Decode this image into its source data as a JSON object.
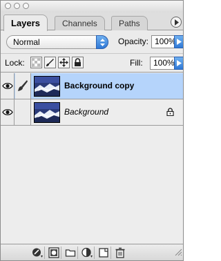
{
  "tabs": [
    {
      "label": "Layers",
      "active": true
    },
    {
      "label": "Channels",
      "active": false
    },
    {
      "label": "Paths",
      "active": false
    }
  ],
  "blend_mode": {
    "value": "Normal"
  },
  "opacity": {
    "label": "Opacity:",
    "value": "100%"
  },
  "lock": {
    "label": "Lock:"
  },
  "fill": {
    "label": "Fill:",
    "value": "100%"
  },
  "layers": [
    {
      "name": "Background copy",
      "selected": true,
      "visible": true,
      "locked": false,
      "bold": true
    },
    {
      "name": "Background",
      "selected": false,
      "visible": true,
      "locked": true,
      "bold": false
    }
  ],
  "colors": {
    "selection": "#b5d4fb",
    "accent_blue": "#2f78d6",
    "panel": "#ebebeb"
  },
  "icons": {
    "bottom_bar": [
      "layer-style-icon",
      "layer-mask-icon",
      "new-group-icon",
      "adjustment-layer-icon",
      "new-layer-icon",
      "trash-icon"
    ]
  }
}
